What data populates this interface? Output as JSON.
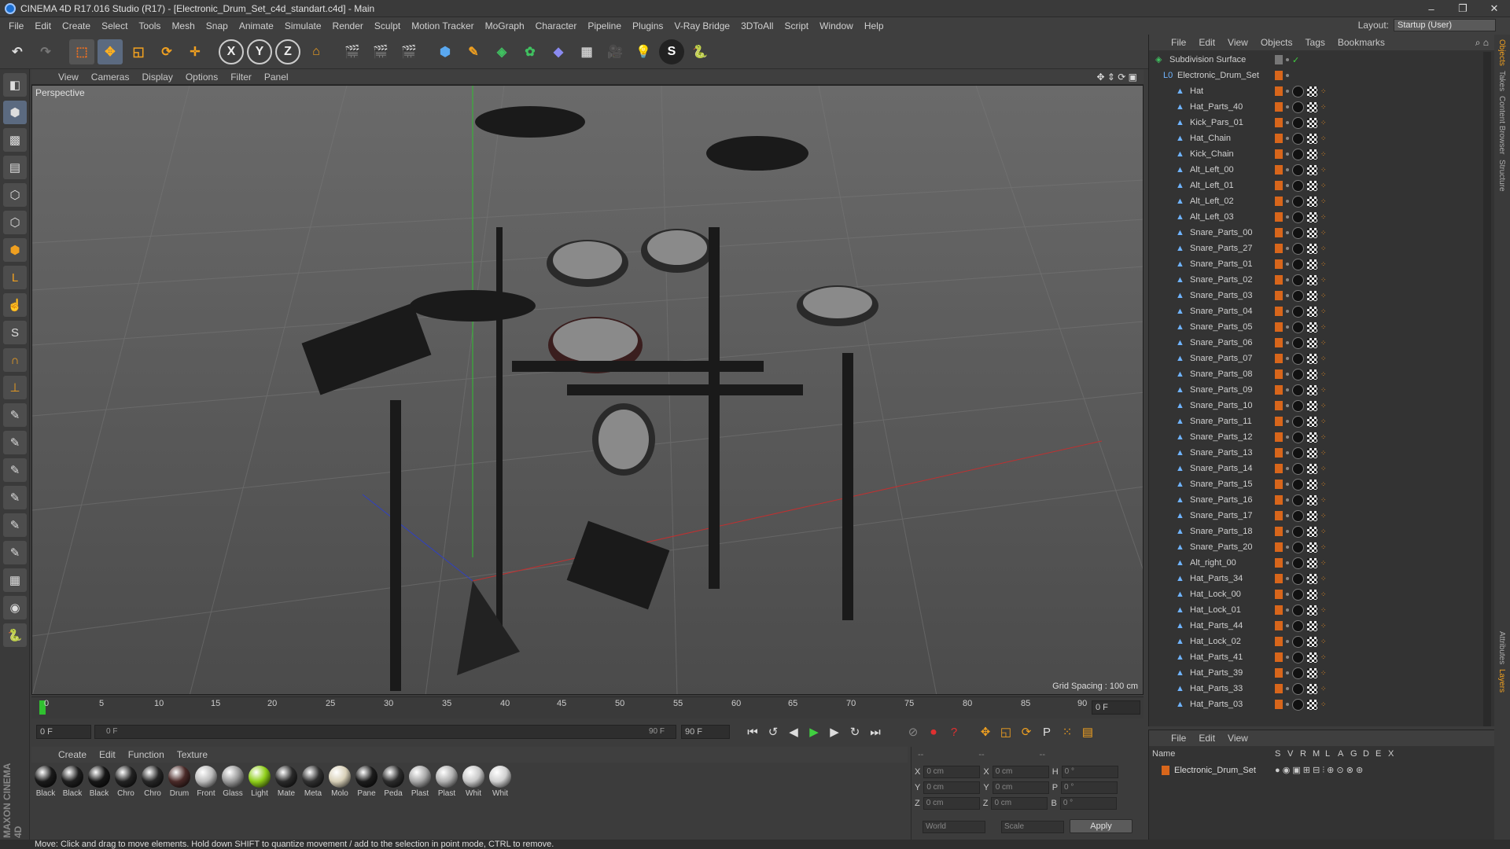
{
  "window": {
    "title": "CINEMA 4D R17.016 Studio (R17) - [Electronic_Drum_Set_c4d_standart.c4d] - Main"
  },
  "menu": [
    "File",
    "Edit",
    "Create",
    "Select",
    "Tools",
    "Mesh",
    "Snap",
    "Animate",
    "Simulate",
    "Render",
    "Sculpt",
    "Motion Tracker",
    "MoGraph",
    "Character",
    "Pipeline",
    "Plugins",
    "V-Ray Bridge",
    "3DToAll",
    "Script",
    "Window",
    "Help"
  ],
  "layout": {
    "label": "Layout:",
    "value": "Startup (User)"
  },
  "viewport": {
    "menu": [
      "View",
      "Cameras",
      "Display",
      "Options",
      "Filter",
      "Panel"
    ],
    "label": "Perspective",
    "grid_spacing": "Grid Spacing : 100 cm"
  },
  "timeline": {
    "ticks": [
      "0",
      "5",
      "10",
      "15",
      "20",
      "25",
      "30",
      "35",
      "40",
      "45",
      "50",
      "55",
      "60",
      "65",
      "70",
      "75",
      "80",
      "85",
      "90"
    ],
    "current_frame": "0 F"
  },
  "transport": {
    "start_field": "0 F",
    "range_start": "0 F",
    "range_end": "90 F",
    "end_field": "90 F"
  },
  "materials": {
    "menu": [
      "Create",
      "Edit",
      "Function",
      "Texture"
    ],
    "items": [
      {
        "label": "Black",
        "color": "#1a1a1a"
      },
      {
        "label": "Black",
        "color": "#1e1e1e"
      },
      {
        "label": "Black",
        "color": "#161616"
      },
      {
        "label": "Chro",
        "color": "#222222"
      },
      {
        "label": "Chro",
        "color": "#262626"
      },
      {
        "label": "Drum",
        "color": "#4a2a28"
      },
      {
        "label": "Front",
        "color": "#bbbbbb"
      },
      {
        "label": "Glass",
        "color": "#9a9a9a"
      },
      {
        "label": "Light",
        "color": "#8fcf1a"
      },
      {
        "label": "Mate",
        "color": "#2a2a2a"
      },
      {
        "label": "Meta",
        "color": "#303030"
      },
      {
        "label": "Molo",
        "color": "#d8d0b8"
      },
      {
        "label": "Pane",
        "color": "#1c1c1c"
      },
      {
        "label": "Peda",
        "color": "#2c2c2c"
      },
      {
        "label": "Plast",
        "color": "#a8a8a8"
      },
      {
        "label": "Plast",
        "color": "#b0b0b0"
      },
      {
        "label": "Whit",
        "color": "#c8c8c8"
      },
      {
        "label": "Whit",
        "color": "#d0d0d0"
      }
    ]
  },
  "coords": {
    "header": [
      "--",
      "--",
      "--"
    ],
    "x_pos": "0 cm",
    "y_pos": "0 cm",
    "z_pos": "0 cm",
    "x_size": "0 cm",
    "y_size": "0 cm",
    "z_size": "0 cm",
    "h": "0 °",
    "p": "0 °",
    "b": "0 °",
    "mode1": "World",
    "mode2": "Scale",
    "apply": "Apply"
  },
  "objects": {
    "menu": [
      "File",
      "Edit",
      "View",
      "Objects",
      "Tags",
      "Bookmarks"
    ],
    "items": [
      "Subdivision Surface",
      "Electronic_Drum_Set",
      "Hat",
      "Hat_Parts_40",
      "Kick_Pars_01",
      "Hat_Chain",
      "Kick_Chain",
      "Alt_Left_00",
      "Alt_Left_01",
      "Alt_Left_02",
      "Alt_Left_03",
      "Snare_Parts_00",
      "Snare_Parts_27",
      "Snare_Parts_01",
      "Snare_Parts_02",
      "Snare_Parts_03",
      "Snare_Parts_04",
      "Snare_Parts_05",
      "Snare_Parts_06",
      "Snare_Parts_07",
      "Snare_Parts_08",
      "Snare_Parts_09",
      "Snare_Parts_10",
      "Snare_Parts_11",
      "Snare_Parts_12",
      "Snare_Parts_13",
      "Snare_Parts_14",
      "Snare_Parts_15",
      "Snare_Parts_16",
      "Snare_Parts_17",
      "Snare_Parts_18",
      "Snare_Parts_20",
      "Alt_right_00",
      "Hat_Parts_34",
      "Hat_Lock_00",
      "Hat_Lock_01",
      "Hat_Parts_44",
      "Hat_Lock_02",
      "Hat_Parts_41",
      "Hat_Parts_39",
      "Hat_Parts_33",
      "Hat_Parts_03"
    ]
  },
  "attributes": {
    "menu": [
      "File",
      "Edit",
      "View"
    ],
    "columns": [
      "Name",
      "S",
      "V",
      "R",
      "M",
      "L",
      "A",
      "G",
      "D",
      "E",
      "X"
    ],
    "row": "Electronic_Drum_Set"
  },
  "side_tabs": [
    "Objects",
    "Takes",
    "Content Browser",
    "Structure"
  ],
  "side_tabs_bottom": [
    "Attributes",
    "Layers"
  ],
  "status": "Move: Click and drag to move elements. Hold down SHIFT to quantize movement / add to the selection in point mode, CTRL to remove.",
  "logo": "MAXON CINEMA 4D",
  "colors": {
    "accent": "#d8661b",
    "icon_blue": "#6fb4ff",
    "axis_red": "#c03030",
    "axis_green": "#30c030"
  }
}
